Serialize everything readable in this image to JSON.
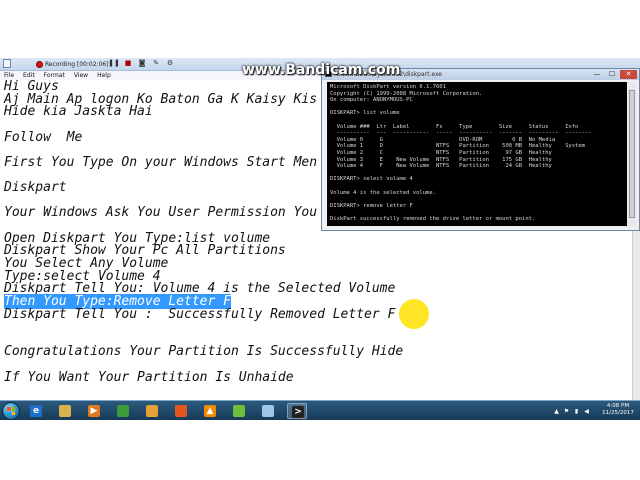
{
  "watermark": "www.Bandicam.com",
  "recorder": {
    "label": "Recording [00:02:06]"
  },
  "notepad": {
    "menu": [
      "File",
      "Edit",
      "Format",
      "View",
      "Help"
    ],
    "lines": [
      "Hi Guys",
      "Aj Main Ap logon Ko Baton Ga K Kaisy Kis",
      "Hide kia Jaskta Hai",
      "",
      "Follow  Me",
      "",
      "First You Type On your Windows Start Men",
      "",
      "Diskpart",
      "",
      "Your Windows Ask You User Permission You",
      "",
      "Open Diskpart You Type:list volume",
      "Diskpart Show Your Pc All Partitions",
      "You Select Any Volume",
      "Type:select Volume 4",
      "Diskpart Tell You: Volume 4 is the Selected Volume",
      "Then You Type:Remove Letter F",
      "Diskpart Tell You :  Successfully Removed Letter F",
      "",
      "",
      "Congratulations Your Partition Is Successfully Hide",
      "",
      "If You Want Your Partition Is Unhaide"
    ],
    "selected_line_index": 17
  },
  "cmd": {
    "title": "C:\\Windows\\System32\\diskpart.exe",
    "close_glyph": "✕",
    "lines": [
      "Microsoft DiskPart version 6.1.7601",
      "Copyright (C) 1999-2008 Microsoft Corporation.",
      "On computer: ANONYMOUS-PC",
      "",
      "DISKPART> list volume",
      "",
      "  Volume ###  Ltr  Label        Fs     Type        Size     Status     Info",
      "  ----------  ---  -----------  -----  ----------  -------  ---------  --------",
      "  Volume 0     G                       DVD-ROM         0 B  No Media",
      "  Volume 1     D                NTFS   Partition    500 MB  Healthy    System",
      "  Volume 2     C                NTFS   Partition     97 GB  Healthy",
      "  Volume 3     E    New Volume  NTFS   Partition    175 GB  Healthy",
      "  Volume 4     F    New Volume  NTFS   Partition     24 GB  Healthy",
      "",
      "DISKPART> select volume 4",
      "",
      "Volume 4 is the selected volume.",
      "",
      "DISKPART> remove letter F",
      "",
      "DiskPart successfully removed the drive letter or mount point.",
      "",
      "DISKPART>"
    ]
  },
  "taskbar": {
    "apps": [
      {
        "name": "internet-explorer",
        "glyph": "e",
        "color": "#1d6fc9"
      },
      {
        "name": "file-explorer",
        "glyph": "",
        "color": "#d8b24a"
      },
      {
        "name": "media-player",
        "glyph": "▶",
        "color": "#e07a1f"
      },
      {
        "name": "chrome",
        "glyph": "",
        "color": "#3b9a3b"
      },
      {
        "name": "photo-app",
        "glyph": "",
        "color": "#e6a236"
      },
      {
        "name": "firefox",
        "glyph": "",
        "color": "#e2571e"
      },
      {
        "name": "vlc",
        "glyph": "▲",
        "color": "#f08a00"
      },
      {
        "name": "bluestacks",
        "glyph": "",
        "color": "#6cbf3a"
      },
      {
        "name": "notepad",
        "glyph": "",
        "color": "#9fc6e4"
      },
      {
        "name": "command-prompt",
        "glyph": ">",
        "color": "#222222"
      }
    ],
    "active_app": "command-prompt",
    "clock": {
      "time": "4:08 PM",
      "date": "11/25/2017"
    }
  }
}
